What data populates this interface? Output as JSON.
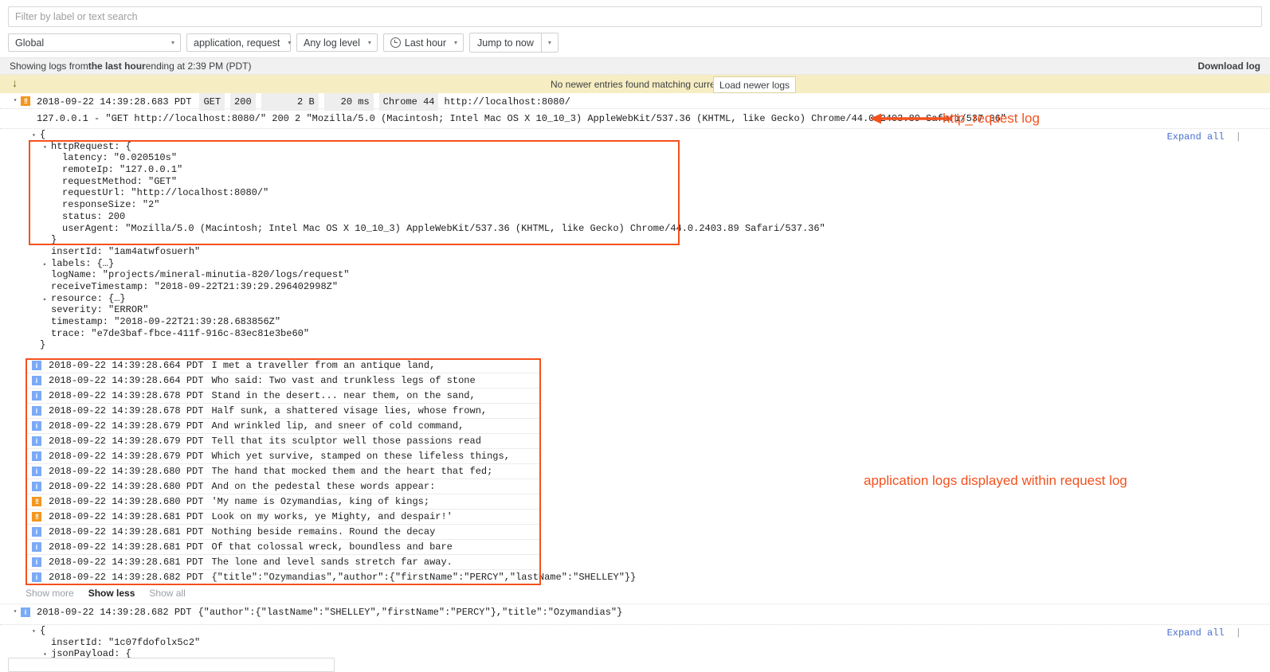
{
  "search": {
    "placeholder": "Filter by label or text search",
    "value": ""
  },
  "filters": {
    "resource": "Global",
    "logs": "application, request",
    "level": "Any log level",
    "time_range": "Last hour",
    "jump": "Jump to now",
    "caret": "▾"
  },
  "strip": {
    "prefix": "Showing logs from ",
    "bold": "the last hour",
    "suffix": " ending at 2:39 PM (PDT)",
    "download": "Download log"
  },
  "banner": {
    "down_arrow": "↓",
    "message": "No newer entries found matching current filter.",
    "load_button": "Load newer logs"
  },
  "request_entry": {
    "twisty": "▾",
    "severity_icon": "!!",
    "timestamp": "2018-09-22 14:39:28.683 PDT",
    "method": "GET",
    "status": "200",
    "size": "2 B",
    "latency": "20 ms",
    "client": "Chrome 44",
    "url": "http://localhost:8080/",
    "raw": "127.0.0.1 - \"GET http://localhost:8080/\" 200 2 \"Mozilla/5.0 (Macintosh; Intel Mac OS X 10_10_3) AppleWebKit/537.36 (KHTML, like Gecko) Chrome/44.0.2403.89 Safari/537.36\"",
    "expand_all": "Expand all",
    "json_lines": [
      {
        "twisty": "▾",
        "indent": 0,
        "text": "{"
      },
      {
        "twisty": "▾",
        "indent": 1,
        "text": "httpRequest: {"
      },
      {
        "twisty": "",
        "indent": 2,
        "text": "latency: \"0.020510s\""
      },
      {
        "twisty": "",
        "indent": 2,
        "text": "remoteIp: \"127.0.0.1\""
      },
      {
        "twisty": "",
        "indent": 2,
        "text": "requestMethod: \"GET\""
      },
      {
        "twisty": "",
        "indent": 2,
        "text": "requestUrl: \"http://localhost:8080/\""
      },
      {
        "twisty": "",
        "indent": 2,
        "text": "responseSize: \"2\""
      },
      {
        "twisty": "",
        "indent": 2,
        "text": "status: 200"
      },
      {
        "twisty": "",
        "indent": 2,
        "text": "userAgent: \"Mozilla/5.0 (Macintosh; Intel Mac OS X 10_10_3) AppleWebKit/537.36 (KHTML, like Gecko) Chrome/44.0.2403.89 Safari/537.36\""
      },
      {
        "twisty": "",
        "indent": 1,
        "text": "}"
      },
      {
        "twisty": "",
        "indent": 1,
        "text": "insertId: \"1am4atwfosuerh\""
      },
      {
        "twisty": "▸",
        "indent": 1,
        "text": "labels: {…}"
      },
      {
        "twisty": "",
        "indent": 1,
        "text": "logName: \"projects/mineral-minutia-820/logs/request\""
      },
      {
        "twisty": "",
        "indent": 1,
        "text": "receiveTimestamp: \"2018-09-22T21:39:29.296402998Z\""
      },
      {
        "twisty": "▸",
        "indent": 1,
        "text": "resource: {…}"
      },
      {
        "twisty": "",
        "indent": 1,
        "text": "severity: \"ERROR\""
      },
      {
        "twisty": "",
        "indent": 1,
        "text": "timestamp: \"2018-09-22T21:39:28.683856Z\""
      },
      {
        "twisty": "",
        "indent": 1,
        "text": "trace: \"e7de3baf-fbce-411f-916c-83ec81e3be60\""
      },
      {
        "twisty": "",
        "indent": 0,
        "text": "}"
      }
    ]
  },
  "app_logs": [
    {
      "severity": "info",
      "icon": "i",
      "timestamp": "2018-09-22 14:39:28.664 PDT",
      "message": "I met a traveller from an antique land,"
    },
    {
      "severity": "info",
      "icon": "i",
      "timestamp": "2018-09-22 14:39:28.664 PDT",
      "message": "Who said: Two vast and trunkless legs of stone"
    },
    {
      "severity": "info",
      "icon": "i",
      "timestamp": "2018-09-22 14:39:28.678 PDT",
      "message": "Stand in the desert... near them, on the sand,"
    },
    {
      "severity": "info",
      "icon": "i",
      "timestamp": "2018-09-22 14:39:28.678 PDT",
      "message": "Half sunk, a shattered visage lies, whose frown,"
    },
    {
      "severity": "info",
      "icon": "i",
      "timestamp": "2018-09-22 14:39:28.679 PDT",
      "message": "And wrinkled lip, and sneer of cold command,"
    },
    {
      "severity": "info",
      "icon": "i",
      "timestamp": "2018-09-22 14:39:28.679 PDT",
      "message": "Tell that its sculptor well those passions read"
    },
    {
      "severity": "info",
      "icon": "i",
      "timestamp": "2018-09-22 14:39:28.679 PDT",
      "message": "Which yet survive, stamped on these lifeless things,"
    },
    {
      "severity": "info",
      "icon": "i",
      "timestamp": "2018-09-22 14:39:28.680 PDT",
      "message": "The hand that mocked them and the heart that fed;"
    },
    {
      "severity": "info",
      "icon": "i",
      "timestamp": "2018-09-22 14:39:28.680 PDT",
      "message": "And on the pedestal these words appear:"
    },
    {
      "severity": "error",
      "icon": "!!",
      "timestamp": "2018-09-22 14:39:28.680 PDT",
      "message": "'My name is Ozymandias, king of kings;"
    },
    {
      "severity": "error",
      "icon": "!!",
      "timestamp": "2018-09-22 14:39:28.681 PDT",
      "message": "Look on my works, ye Mighty, and despair!'"
    },
    {
      "severity": "info",
      "icon": "i",
      "timestamp": "2018-09-22 14:39:28.681 PDT",
      "message": "Nothing beside remains. Round the decay"
    },
    {
      "severity": "info",
      "icon": "i",
      "timestamp": "2018-09-22 14:39:28.681 PDT",
      "message": "Of that colossal wreck, boundless and bare"
    },
    {
      "severity": "info",
      "icon": "i",
      "timestamp": "2018-09-22 14:39:28.681 PDT",
      "message": "The lone and level sands stretch far away."
    },
    {
      "severity": "info",
      "icon": "i",
      "timestamp": "2018-09-22 14:39:28.682 PDT",
      "message": "{\"title\":\"Ozymandias\",\"author\":{\"firstName\":\"PERCY\",\"lastName\":\"SHELLEY\"}}"
    }
  ],
  "show_controls": {
    "more": "Show more",
    "less": "Show less",
    "all": "Show all"
  },
  "second_entry": {
    "twisty": "▾",
    "severity_icon": "i",
    "timestamp": "2018-09-22 14:39:28.682 PDT",
    "message": "{\"author\":{\"lastName\":\"SHELLEY\",\"firstName\":\"PERCY\"},\"title\":\"Ozymandias\"}",
    "expand_all": "Expand all",
    "json_lines": [
      {
        "twisty": "▾",
        "indent": 0,
        "text": "{"
      },
      {
        "twisty": "",
        "indent": 1,
        "text": "insertId: \"1c07fdofolx5c2\""
      },
      {
        "twisty": "▾",
        "indent": 1,
        "text": "jsonPayload: {"
      }
    ]
  },
  "annotations": {
    "http_request": "http_request log",
    "application_logs": "application logs displayed within request log"
  },
  "colors": {
    "annotation": "#f4511e",
    "highlight_box": "#f4511e",
    "severity_error": "#f4961e",
    "severity_info": "#7baaf7",
    "banner_bg": "#f7edc3",
    "link": "#4a6fd4"
  }
}
